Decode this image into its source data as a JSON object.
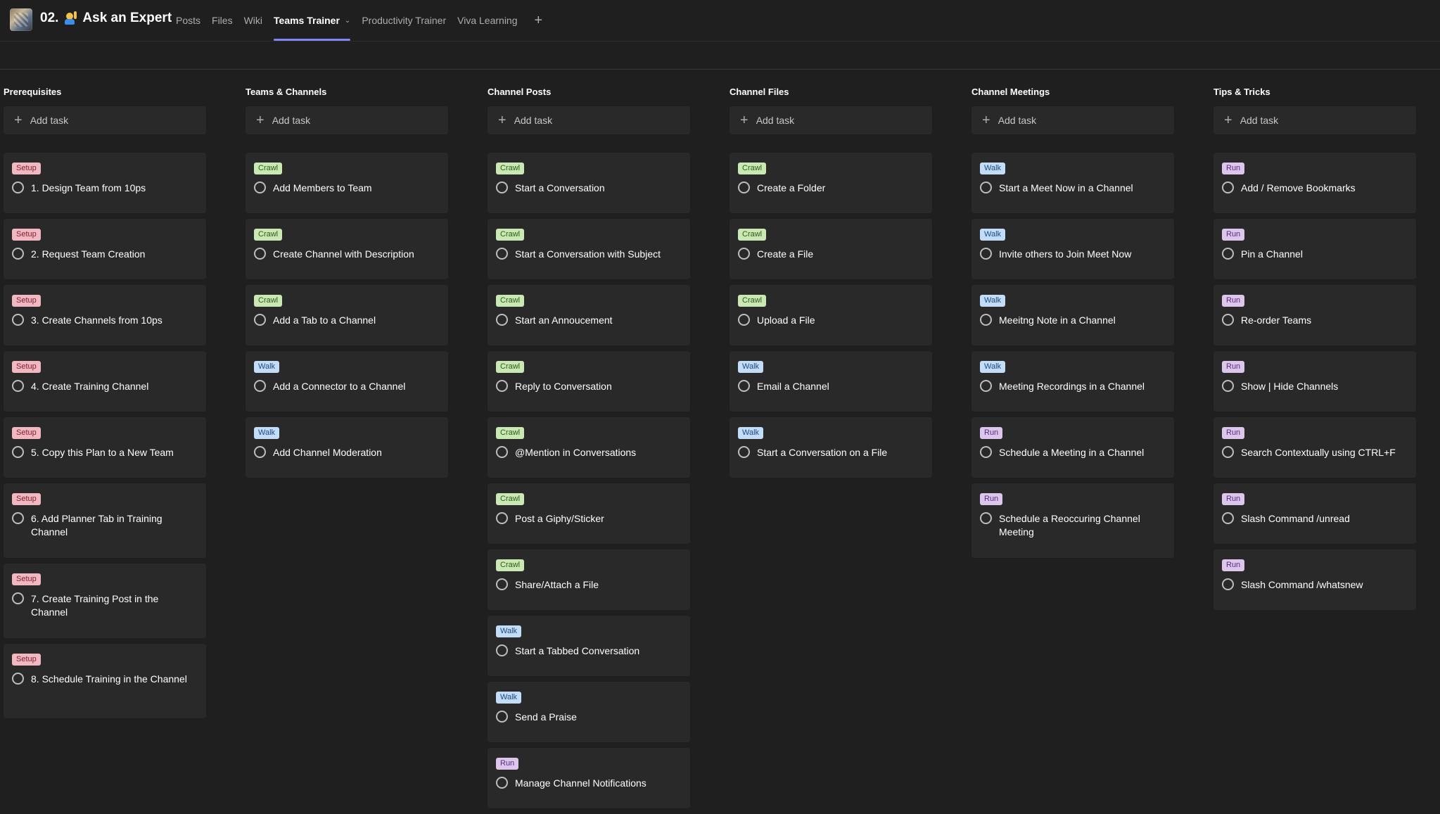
{
  "header": {
    "team_name": "02.",
    "team_title": "Ask an Expert",
    "tabs": [
      {
        "label": "Posts"
      },
      {
        "label": "Files"
      },
      {
        "label": "Wiki"
      },
      {
        "label": "Teams Trainer"
      },
      {
        "label": "Productivity Trainer"
      },
      {
        "label": "Viva Learning"
      }
    ],
    "active_tab": "Teams Trainer",
    "add_tab_icon": "plus-icon"
  },
  "board": {
    "add_task_label": "Add task",
    "label_colors": {
      "Setup": "#f1b8c1",
      "Crawl": "#c9e8b4",
      "Walk": "#c3dcf7",
      "Run": "#dcc6ec"
    },
    "buckets": [
      {
        "title": "Prerequisites",
        "tasks": [
          {
            "label": "Setup",
            "title": "1. Design Team from 10ps"
          },
          {
            "label": "Setup",
            "title": "2. Request Team Creation"
          },
          {
            "label": "Setup",
            "title": "3. Create Channels from 10ps"
          },
          {
            "label": "Setup",
            "title": "4. Create Training Channel"
          },
          {
            "label": "Setup",
            "title": "5. Copy this Plan to a New Team"
          },
          {
            "label": "Setup",
            "title": "6. Add Planner Tab in Training Channel"
          },
          {
            "label": "Setup",
            "title": "7. Create Training Post in the Channel"
          },
          {
            "label": "Setup",
            "title": "8. Schedule Training in the Channel"
          }
        ]
      },
      {
        "title": "Teams & Channels",
        "tasks": [
          {
            "label": "Crawl",
            "title": "Add Members to Team"
          },
          {
            "label": "Crawl",
            "title": "Create Channel with Description"
          },
          {
            "label": "Crawl",
            "title": "Add a Tab to a Channel"
          },
          {
            "label": "Walk",
            "title": "Add a Connector to a Channel"
          },
          {
            "label": "Walk",
            "title": "Add Channel Moderation"
          }
        ]
      },
      {
        "title": "Channel Posts",
        "tasks": [
          {
            "label": "Crawl",
            "title": "Start a Conversation"
          },
          {
            "label": "Crawl",
            "title": "Start a Conversation with Subject"
          },
          {
            "label": "Crawl",
            "title": "Start an Annoucement"
          },
          {
            "label": "Crawl",
            "title": "Reply to Conversation"
          },
          {
            "label": "Crawl",
            "title": "@Mention in Conversations"
          },
          {
            "label": "Crawl",
            "title": "Post a Giphy/Sticker"
          },
          {
            "label": "Crawl",
            "title": "Share/Attach a File"
          },
          {
            "label": "Walk",
            "title": "Start a Tabbed Conversation"
          },
          {
            "label": "Walk",
            "title": "Send a Praise"
          },
          {
            "label": "Run",
            "title": "Manage Channel Notifications"
          }
        ]
      },
      {
        "title": "Channel Files",
        "tasks": [
          {
            "label": "Crawl",
            "title": "Create a Folder"
          },
          {
            "label": "Crawl",
            "title": "Create a File"
          },
          {
            "label": "Crawl",
            "title": "Upload a File"
          },
          {
            "label": "Walk",
            "title": "Email a Channel"
          },
          {
            "label": "Walk",
            "title": "Start a Conversation on a File"
          }
        ]
      },
      {
        "title": "Channel Meetings",
        "tasks": [
          {
            "label": "Walk",
            "title": "Start a Meet Now in a Channel"
          },
          {
            "label": "Walk",
            "title": "Invite others to Join Meet Now"
          },
          {
            "label": "Walk",
            "title": "Meeitng Note in a Channel"
          },
          {
            "label": "Walk",
            "title": "Meeting Recordings in a Channel"
          },
          {
            "label": "Run",
            "title": "Schedule a Meeting in a Channel"
          },
          {
            "label": "Run",
            "title": "Schedule a Reoccuring Channel Meeting"
          }
        ]
      },
      {
        "title": "Tips & Tricks",
        "tasks": [
          {
            "label": "Run",
            "title": "Add / Remove Bookmarks"
          },
          {
            "label": "Run",
            "title": "Pin a Channel"
          },
          {
            "label": "Run",
            "title": "Re-order Teams"
          },
          {
            "label": "Run",
            "title": "Show | Hide Channels"
          },
          {
            "label": "Run",
            "title": "Search Contextually using CTRL+F"
          },
          {
            "label": "Run",
            "title": "Slash Command /unread"
          },
          {
            "label": "Run",
            "title": "Slash Command /whatsnew"
          }
        ]
      }
    ]
  }
}
